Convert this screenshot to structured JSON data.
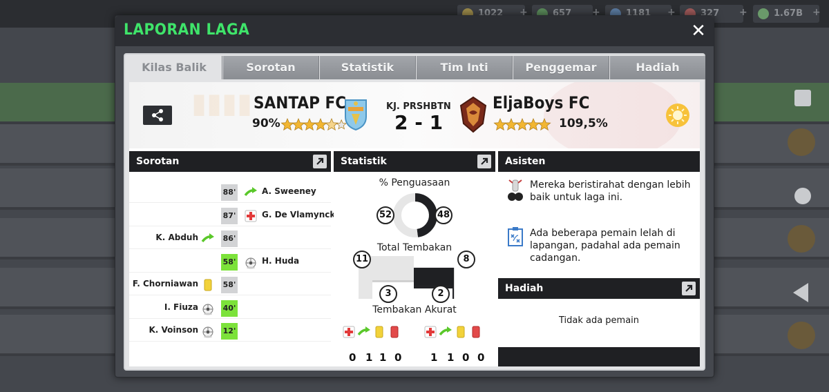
{
  "background": {
    "resources": [
      "1022",
      "657",
      "1181",
      "327",
      "1.67B"
    ]
  },
  "modal": {
    "title": "LAPORAN LAGA",
    "close_icon": "close-icon"
  },
  "tabs": [
    {
      "label": "Kilas Balik",
      "active": true
    },
    {
      "label": "Sorotan",
      "active": false
    },
    {
      "label": "Statistik",
      "active": false
    },
    {
      "label": "Tim Inti",
      "active": false
    },
    {
      "label": "Penggemar",
      "active": false
    },
    {
      "label": "Hadiah",
      "active": false
    }
  ],
  "match": {
    "home_team": "SANTAP FC",
    "home_rating": "90%",
    "home_stars": 4.5,
    "result_label": "KJ. PRSHBTN",
    "score": "2 - 1",
    "away_team": "EljaBoys FC",
    "away_rating": "109,5%",
    "away_stars": 5.5,
    "weather_icon": "sun-icon"
  },
  "highlights": {
    "title": "Sorotan",
    "rows": [
      {
        "minute": "88'",
        "side": "right",
        "player": "A. Sweeney",
        "icon": "substitution-icon",
        "green": false
      },
      {
        "minute": "87'",
        "side": "right",
        "player": "G. De Vlamynck",
        "icon": "injury-icon",
        "green": false
      },
      {
        "minute": "86'",
        "side": "left",
        "player": "K. Abduh",
        "icon": "substitution-icon",
        "green": false
      },
      {
        "minute": "58'",
        "side": "right",
        "player": "H. Huda",
        "icon": "ball-icon",
        "green": true
      },
      {
        "minute": "58'",
        "side": "left",
        "player": "F. Chorniawan",
        "icon": "yellow-card-icon",
        "green": false
      },
      {
        "minute": "40'",
        "side": "left",
        "player": "I. Fiuza",
        "icon": "ball-icon",
        "green": true
      },
      {
        "minute": "12'",
        "side": "left",
        "player": "K. Voinson",
        "icon": "ball-icon",
        "green": true
      }
    ]
  },
  "stats": {
    "title": "Statistik",
    "possession_label": "% Penguasaan",
    "possession_home": 52,
    "possession_away": 48,
    "shots_label": "Total Tembakan",
    "shots_home": 11,
    "shots_away": 8,
    "accurate_label": "Tembakan Akurat",
    "accurate_home": 3,
    "accurate_away": 2,
    "events_home": [
      "0",
      "1",
      "1",
      "0"
    ],
    "events_away": [
      "1",
      "1",
      "0",
      "0"
    ]
  },
  "assist": {
    "title": "Asisten",
    "tips": [
      "Mereka beristirahat dengan lebih baik untuk laga ini.",
      "Ada beberapa pemain lelah di lapangan, padahal ada pemain cadangan."
    ]
  },
  "reward": {
    "title": "Hadiah",
    "empty_text": "Tidak ada pemain"
  },
  "colors": {
    "title_green": "#3fe46a",
    "minute_green": "#7ce23a",
    "star_gold": "#f2b632"
  }
}
